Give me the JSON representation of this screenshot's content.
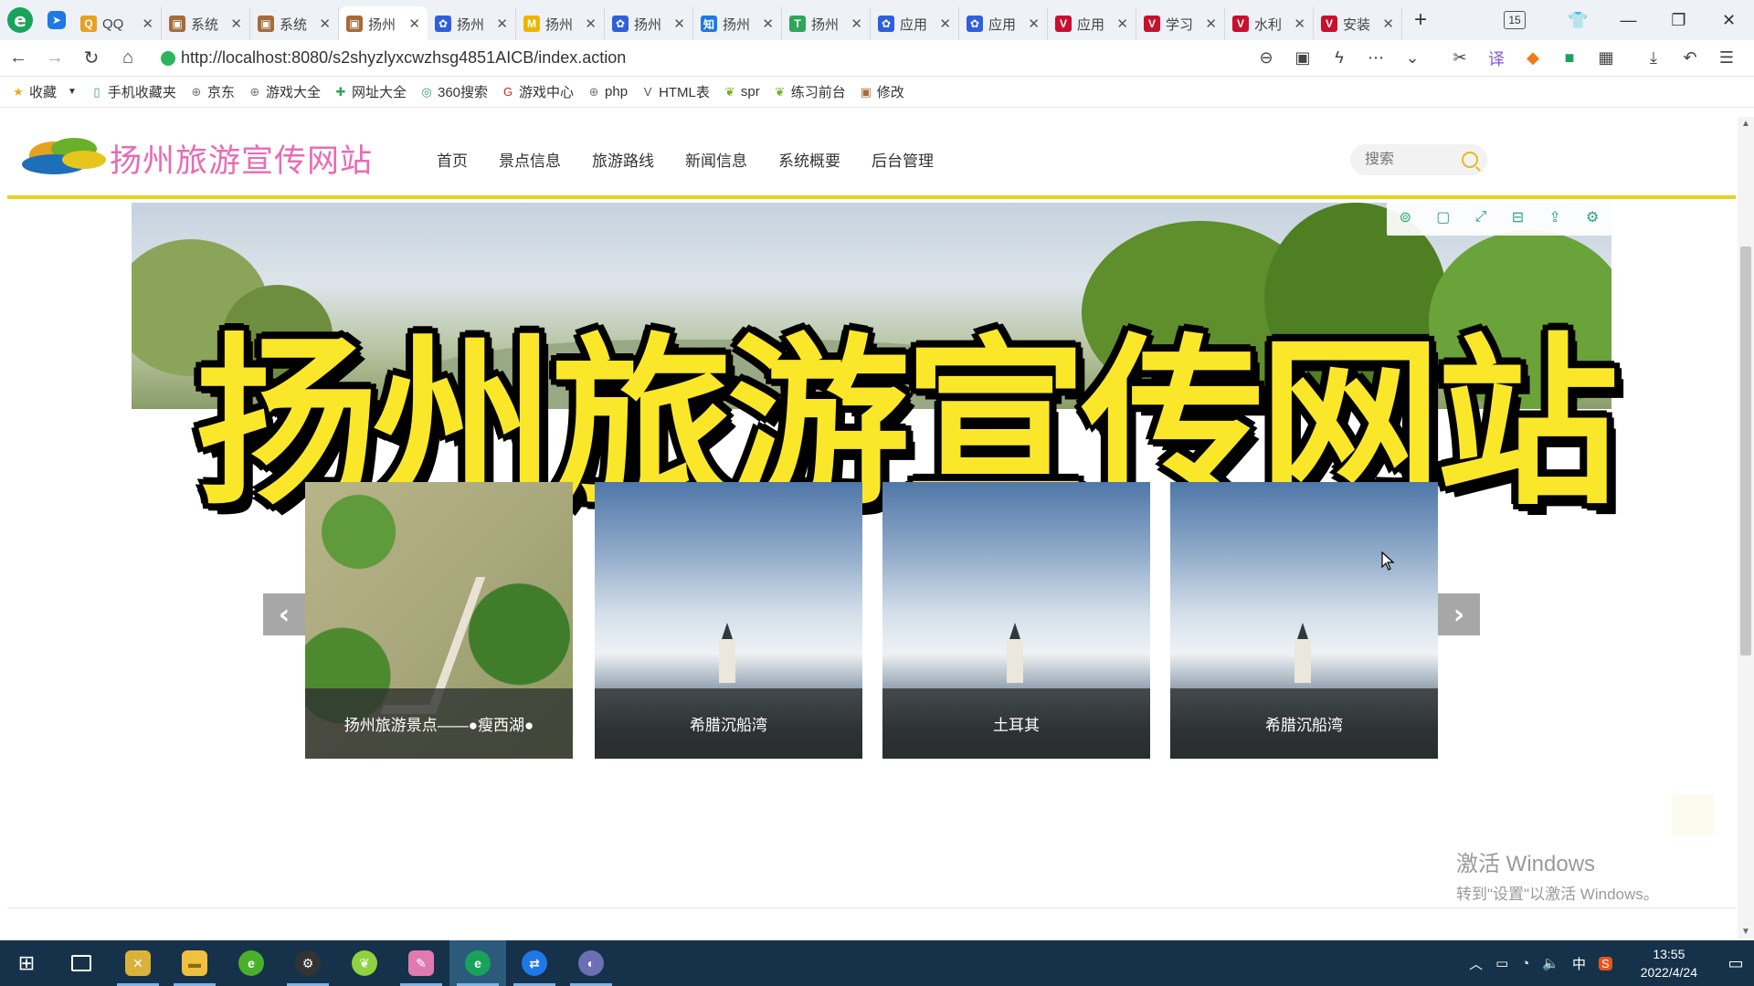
{
  "browser": {
    "tabs": [
      {
        "label": "QQ",
        "fav_color": "#e8a020",
        "fav_glyph": "Q"
      },
      {
        "label": "系统",
        "fav_color": "#a56b3a",
        "fav_glyph": "▣"
      },
      {
        "label": "系统",
        "fav_color": "#a56b3a",
        "fav_glyph": "▣"
      },
      {
        "label": "扬州",
        "fav_color": "#a56b3a",
        "fav_glyph": "▣",
        "active": true
      },
      {
        "label": "扬州",
        "fav_color": "#2f5fdc",
        "fav_glyph": "✿"
      },
      {
        "label": "扬州",
        "fav_color": "#f0b400",
        "fav_glyph": "M"
      },
      {
        "label": "扬州",
        "fav_color": "#2f5fdc",
        "fav_glyph": "✿"
      },
      {
        "label": "扬州",
        "fav_color": "#1e78e6",
        "fav_glyph": "知"
      },
      {
        "label": "扬州",
        "fav_color": "#2fa55a",
        "fav_glyph": "T"
      },
      {
        "label": "应用",
        "fav_color": "#2f5fdc",
        "fav_glyph": "✿"
      },
      {
        "label": "应用",
        "fav_color": "#2f5fdc",
        "fav_glyph": "✿"
      },
      {
        "label": "应用",
        "fav_color": "#c8102e",
        "fav_glyph": "V"
      },
      {
        "label": "学习",
        "fav_color": "#c8102e",
        "fav_glyph": "V"
      },
      {
        "label": "水利",
        "fav_color": "#c8102e",
        "fav_glyph": "V"
      },
      {
        "label": "安装",
        "fav_color": "#c8102e",
        "fav_glyph": "V"
      }
    ],
    "tab_count": "15",
    "url": "http://localhost:8080/s2shyzlyxcwzhsg4851AICB/index.action",
    "bookmarks": [
      {
        "label": "收藏",
        "icon": "star-icon",
        "glyph": "★",
        "color": "#f0a81c"
      },
      {
        "label": "手机收藏夹",
        "icon": "phone-icon",
        "glyph": "▯",
        "color": "#2fa55a"
      },
      {
        "label": "京东",
        "icon": "globe-icon",
        "glyph": "⊕",
        "color": "#777"
      },
      {
        "label": "游戏大全",
        "icon": "globe-icon",
        "glyph": "⊕",
        "color": "#777"
      },
      {
        "label": "网址大全",
        "icon": "nav-icon",
        "glyph": "✚",
        "color": "#2fa55a"
      },
      {
        "label": "360搜索",
        "icon": "search-icon",
        "glyph": "◎",
        "color": "#2fa55a"
      },
      {
        "label": "游戏中心",
        "icon": "game-icon",
        "glyph": "G",
        "color": "#d6262b"
      },
      {
        "label": "php",
        "icon": "globe-icon",
        "glyph": "⊕",
        "color": "#777"
      },
      {
        "label": "HTML表",
        "icon": "page-icon",
        "glyph": "V",
        "color": "#555"
      },
      {
        "label": "spr",
        "icon": "leaf-icon",
        "glyph": "❦",
        "color": "#7cae1f"
      },
      {
        "label": "练习前台",
        "icon": "leaf-icon",
        "glyph": "❦",
        "color": "#7cae1f"
      },
      {
        "label": "修改",
        "icon": "image-icon",
        "glyph": "▣",
        "color": "#a56b3a"
      }
    ]
  },
  "site": {
    "logo_text": "扬州旅游宣传网站",
    "nav": [
      "首页",
      "景点信息",
      "旅游路线",
      "新闻信息",
      "系统概要",
      "后台管理"
    ],
    "search_placeholder": "搜索",
    "hero_title": "扬州旅游宣传网站",
    "carousel": [
      {
        "caption": "扬州旅游景点——●瘦西湖●",
        "image": "garden"
      },
      {
        "caption": "希腊沉船湾",
        "image": "lake"
      },
      {
        "caption": "土耳其",
        "image": "lake"
      },
      {
        "caption": "希腊沉船湾",
        "image": "lake"
      }
    ]
  },
  "watermark": {
    "line1": "激活 Windows",
    "line2": "转到\"设置\"以激活 Windows。"
  },
  "taskbar": {
    "time": "13:55",
    "date": "2022/4/24",
    "ime": "中"
  }
}
